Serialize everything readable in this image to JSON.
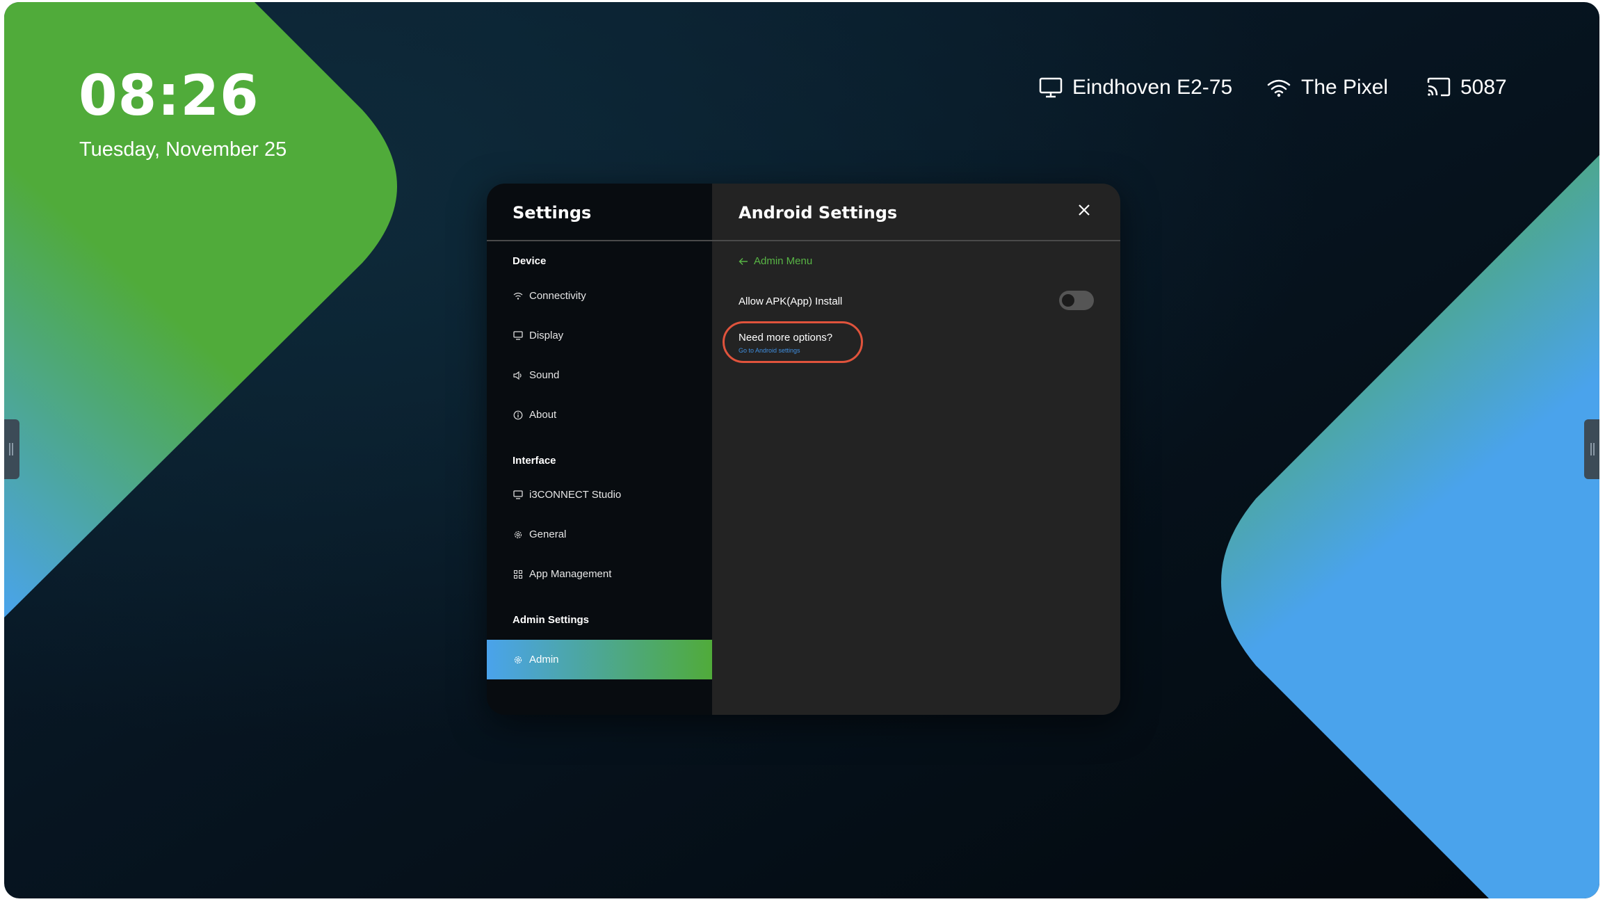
{
  "home": {
    "clock": "08:26",
    "date": "Tuesday, November 25",
    "status": {
      "display_name": "Eindhoven E2-75",
      "wifi_name": "The Pixel",
      "cast_code": "5087"
    }
  },
  "settings": {
    "title": "Settings",
    "sections": [
      {
        "label": "Device",
        "items": [
          {
            "label": "Connectivity",
            "icon": "wifi-icon"
          },
          {
            "label": "Display",
            "icon": "monitor-icon"
          },
          {
            "label": "Sound",
            "icon": "speaker-icon"
          },
          {
            "label": "About",
            "icon": "info-icon"
          }
        ]
      },
      {
        "label": "Interface",
        "items": [
          {
            "label": "i3CONNECT Studio",
            "icon": "monitor-icon"
          },
          {
            "label": "General",
            "icon": "gear-icon"
          },
          {
            "label": "App Management",
            "icon": "grid-icon"
          }
        ]
      },
      {
        "label": "Admin Settings",
        "items": [
          {
            "label": "Admin",
            "icon": "gear-icon",
            "active": true
          }
        ]
      }
    ]
  },
  "android": {
    "title": "Android Settings",
    "back_label": "Admin Menu",
    "apk_label": "Allow APK(App) Install",
    "apk_enabled": false,
    "more_title": "Need more options?",
    "more_link": "Go to Android settings"
  },
  "colors": {
    "accent_green": "#50ab3a",
    "accent_blue": "#4aa3ec",
    "highlight_red": "#e0533c"
  }
}
